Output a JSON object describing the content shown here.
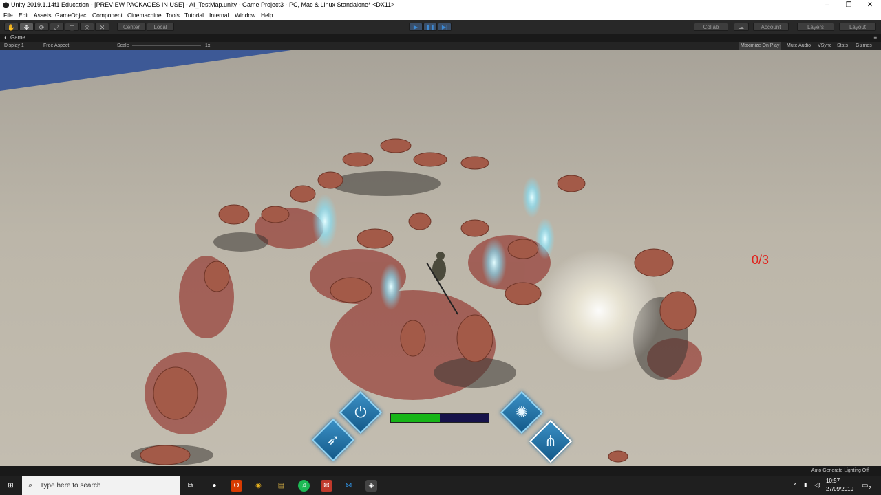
{
  "window": {
    "title": "Unity 2019.1.14f1 Education - [PREVIEW PACKAGES IN USE] - AI_TestMap.unity - Game Project3 - PC, Mac & Linux Standalone* <DX11>",
    "minimize_glyph": "–",
    "maximize_glyph": "❐",
    "close_glyph": "✕"
  },
  "menu": [
    "File",
    "Edit",
    "Assets",
    "GameObject",
    "Component",
    "Cinemachine",
    "Tools",
    "Tutorial",
    "Internal",
    "Window",
    "Help"
  ],
  "toolbar": {
    "tools": [
      "hand-icon",
      "move-icon",
      "rotate-icon",
      "scale-icon",
      "rect-icon",
      "transform-icon",
      "custom-icon"
    ],
    "tool_glyphs": [
      "✋",
      "✥",
      "⟳",
      "⤢",
      "▢",
      "◎",
      "✕"
    ],
    "center_label": "Center",
    "local_label": "Local",
    "play_glyph": "▶",
    "pause_glyph": "❚❚",
    "step_glyph": "▶|",
    "collab_label": "Collab",
    "cloud_glyph": "☁",
    "account_label": "Account",
    "layers_label": "Layers",
    "layout_label": "Layout",
    "menu_glyph": "≡"
  },
  "game_tab": {
    "label": "Game",
    "display": "Display 1",
    "aspect": "Free Aspect",
    "scale_label": "Scale",
    "scale_value": "1x",
    "maximize_on_play": "Maximize On Play",
    "mute_audio": "Mute Audio",
    "vsync": "VSync",
    "stats": "Stats",
    "gizmos": "Gizmos"
  },
  "hud": {
    "kill_counter": "0/3",
    "health_fraction": 0.5,
    "ability_glyphs": [
      "⏻",
      "➶",
      "✺",
      "⋔"
    ]
  },
  "colors": {
    "health": "#17b517",
    "counter": "#e0201a",
    "ability": "#2d7fb5",
    "creature": "#a35a48",
    "blood": "#8a1a14",
    "crystal": "#aef2ff"
  },
  "editor_status": "Auto Generate Lighting Off",
  "taskbar": {
    "search_placeholder": "Type here to search",
    "apps": [
      "task-view-icon",
      "app-icon",
      "office-icon",
      "chrome-icon",
      "file-explorer-icon",
      "spotify-icon",
      "app2-icon",
      "vscode-icon",
      "unity-icon"
    ],
    "app_glyphs": [
      "⧉",
      "●",
      "O",
      "◉",
      "▤",
      "♫",
      "✉",
      "⋈",
      "◈"
    ],
    "time": "10:57",
    "date": "27/09/2019",
    "notifications": "2"
  }
}
